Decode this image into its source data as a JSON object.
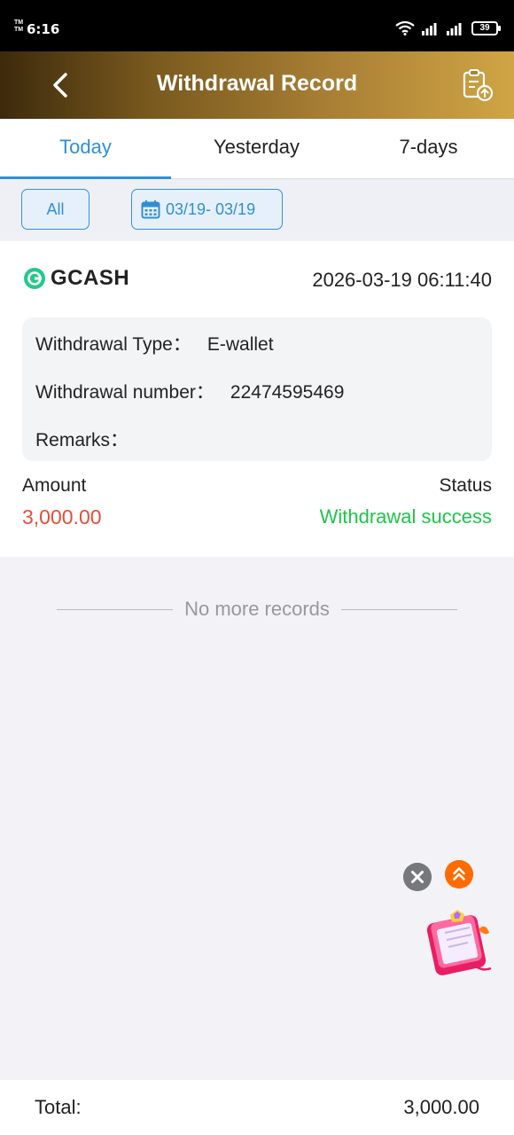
{
  "status_bar": {
    "time": "6:16",
    "tm_label": "TM",
    "battery": "39"
  },
  "header": {
    "title": "Withdrawal Record"
  },
  "tabs": [
    {
      "label": "Today",
      "active": true
    },
    {
      "label": "Yesterday",
      "active": false
    },
    {
      "label": "7-days",
      "active": false
    }
  ],
  "filters": {
    "all_label": "All",
    "date_range": "03/19- 03/19"
  },
  "record": {
    "provider": "GCASH",
    "datetime": "2026-03-19 06:11:40",
    "type_label": "Withdrawal Type：",
    "type_value": "E-wallet",
    "number_label": "Withdrawal number：",
    "number_value": "22474595469",
    "remarks_label": "Remarks：",
    "remarks_value": "",
    "amount_label": "Amount",
    "amount_value": "3,000.00",
    "status_label": "Status",
    "status_value": "Withdrawal success"
  },
  "list_end_text": "No more records",
  "footer": {
    "total_label": "Total:",
    "total_value": "3,000.00"
  },
  "colors": {
    "accent": "#2f8fd6",
    "amount": "#e74c3c",
    "success": "#1fc44a",
    "float_up": "#ff6b00",
    "float_close": "#77787c"
  }
}
